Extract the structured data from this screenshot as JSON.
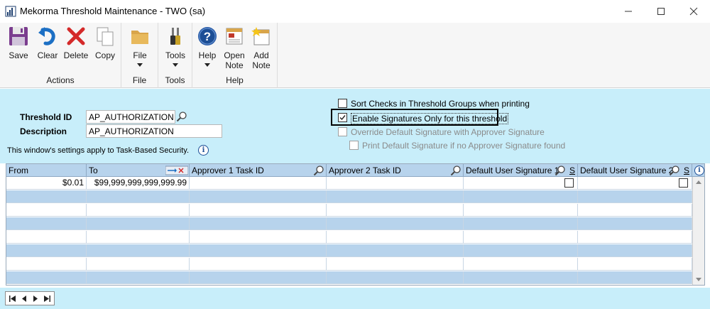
{
  "window": {
    "title": "Mekorma Threshold Maintenance  -  TWO (sa)",
    "minimize": "—",
    "maximize": "☐",
    "close": "✕"
  },
  "ribbon": {
    "groups": [
      {
        "label": "Actions",
        "buttons": [
          {
            "label": "Save",
            "icon": "save-icon"
          },
          {
            "label": "Clear",
            "icon": "clear-icon"
          },
          {
            "label": "Delete",
            "icon": "delete-icon"
          },
          {
            "label": "Copy",
            "icon": "copy-icon"
          }
        ]
      },
      {
        "label": "File",
        "buttons": [
          {
            "label": "File",
            "icon": "folder-icon"
          }
        ]
      },
      {
        "label": "Tools",
        "buttons": [
          {
            "label": "Tools",
            "icon": "tools-icon"
          }
        ]
      },
      {
        "label": "Help",
        "buttons": [
          {
            "label": "Help",
            "icon": "help-icon"
          },
          {
            "label": "Open\nNote",
            "icon": "open-note-icon"
          },
          {
            "label": "Add\nNote",
            "icon": "add-note-icon"
          }
        ]
      }
    ]
  },
  "form": {
    "threshold_id_label": "Threshold ID",
    "threshold_id_value": "AP_AUTHORIZATION",
    "description_label": "Description",
    "description_value": "AP_AUTHORIZATION",
    "security_note": "This window's settings apply to Task-Based Security.",
    "options": [
      {
        "label": "Sort Checks in Threshold Groups when printing",
        "checked": false,
        "enabled": true
      },
      {
        "label": "Enable Signatures Only for this threshold",
        "checked": true,
        "enabled": true
      },
      {
        "label": "Override Default Signature with Approver Signature",
        "checked": false,
        "enabled": false
      },
      {
        "label": "Print Default Signature if no Approver Signature found",
        "checked": false,
        "enabled": false
      }
    ]
  },
  "grid": {
    "columns": {
      "from": "From",
      "to": "To",
      "approver1": "Approver 1 Task ID",
      "approver2": "Approver 2 Task ID",
      "default_sig1": "Default User Signature 1",
      "default_sig2": "Default User Signature 2",
      "s": "S"
    },
    "rows": [
      {
        "from": "$0.01",
        "to": "$99,999,999,999,999.99",
        "approver1": "",
        "approver2": "",
        "sig1": false,
        "sig2": false
      }
    ]
  },
  "colors": {
    "form_bg": "#c8eefa",
    "grid_header": "#b7d3ec",
    "icon_blue": "#1c4e95"
  }
}
